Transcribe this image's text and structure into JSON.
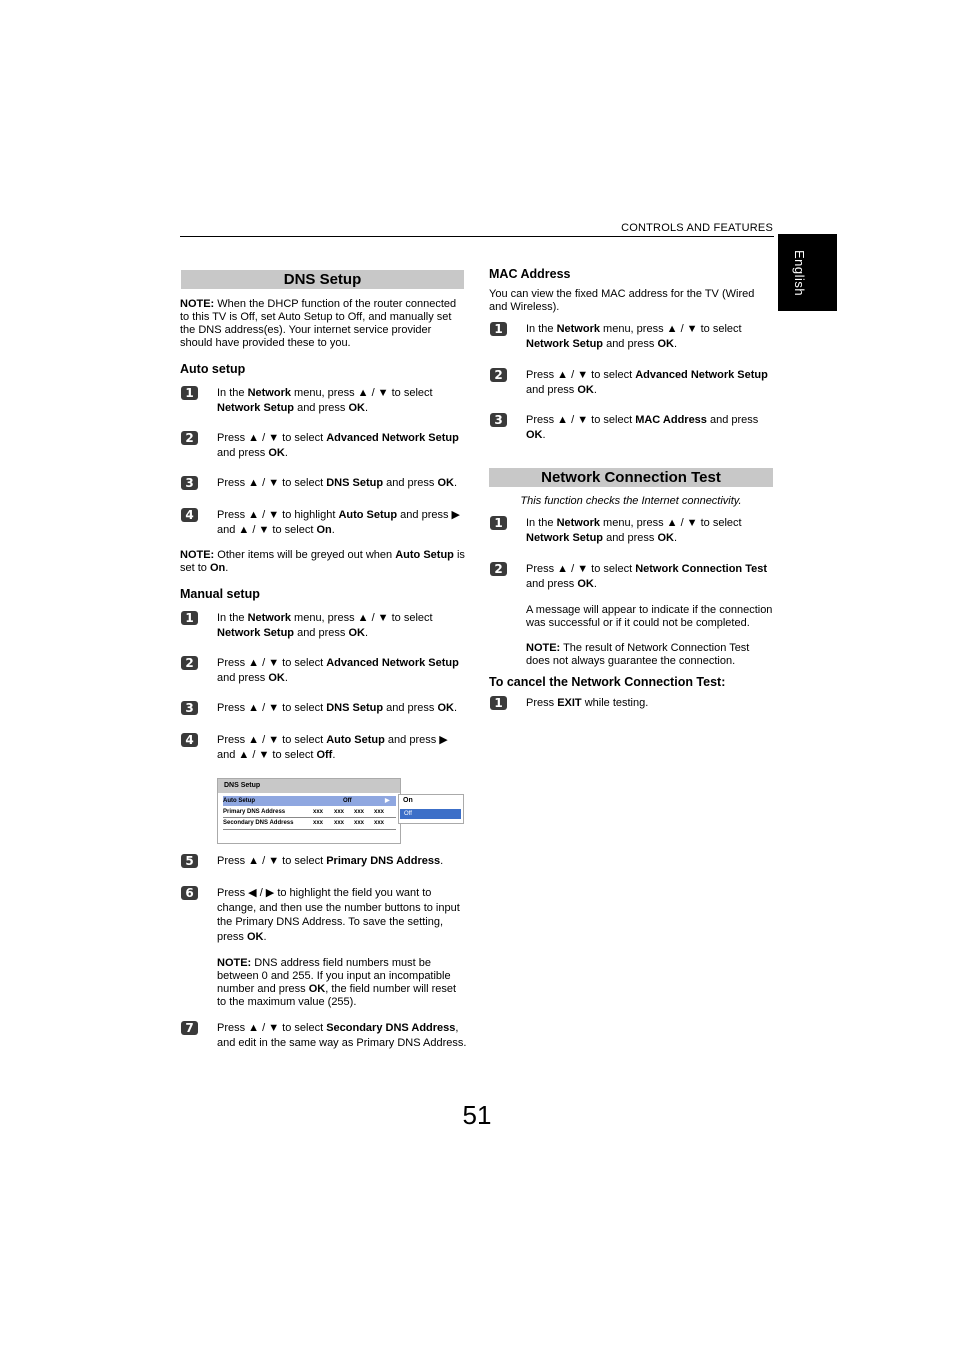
{
  "header": {
    "section_label": "CONTROLS AND FEATURES",
    "language_tab": "English"
  },
  "dns_setup": {
    "title": "DNS Setup",
    "note_label": "NOTE:",
    "note_text": " When the DHCP function of the router connected to this TV is Off, set Auto Setup to Off, and manually set the DNS address(es). Your internet service provider should have provided these to you.",
    "auto_setup": {
      "heading": "Auto setup",
      "steps": [
        {
          "num": "1",
          "html": "In the <b>Network</b> menu, press ▲ / ▼ to select <b>Network Setup</b> and press <b>OK</b>."
        },
        {
          "num": "2",
          "html": "Press ▲ / ▼ to select <b>Advanced Network Setup</b> and press <b>OK</b>."
        },
        {
          "num": "3",
          "html": "Press ▲ / ▼ to select <b>DNS Setup</b> and press <b>OK</b>."
        },
        {
          "num": "4",
          "html": "Press ▲ / ▼ to highlight <b>Auto Setup</b> and press ▶ and ▲ / ▼ to select <b>On</b>."
        }
      ],
      "note_html": "<b>NOTE:</b> Other items will be greyed out when <b>Auto Setup</b> is set to <b>On</b>."
    },
    "manual_setup": {
      "heading": "Manual setup",
      "steps": [
        {
          "num": "1",
          "html": "In the <b>Network</b> menu, press ▲ / ▼ to select <b>Network Setup</b> and press <b>OK</b>."
        },
        {
          "num": "2",
          "html": "Press ▲ / ▼ to select <b>Advanced Network Setup</b> and press <b>OK</b>."
        },
        {
          "num": "3",
          "html": "Press ▲ / ▼ to select <b>DNS Setup</b> and press <b>OK</b>."
        },
        {
          "num": "4",
          "html": "Press ▲ / ▼ to select <b>Auto Setup</b> and press ▶ and ▲ / ▼ to select <b>Off</b>."
        },
        {
          "num": "5",
          "html": "Press ▲ / ▼ to select <b>Primary DNS Address</b>."
        },
        {
          "num": "6",
          "html": "Press ◀ / ▶ to highlight the field you want to change, and then use the number buttons to input the Primary DNS Address. To save the setting, press <b>OK</b>."
        },
        {
          "num": "7",
          "html": "Press ▲ / ▼ to select <b>Secondary DNS Address</b>, and edit in the same way as Primary DNS Address."
        }
      ],
      "step6_note_html": "<b>NOTE:</b> DNS address field numbers must be between 0 and 255. If you input an incompatible number and press <b>OK</b>, the field number will reset to the maximum value (255)."
    },
    "osd": {
      "title": "DNS Setup",
      "rows": [
        {
          "label": "Auto Setup",
          "value": "Off",
          "arrow": "▶"
        },
        {
          "label": "Primary DNS Address",
          "fields": [
            "xxx",
            "xxx",
            "xxx",
            "xxx"
          ]
        },
        {
          "label": "Secondary DNS Address",
          "fields": [
            "xxx",
            "xxx",
            "xxx",
            "xxx"
          ]
        }
      ],
      "popup_options": [
        "On",
        "Off"
      ],
      "popup_selected": "Off"
    }
  },
  "mac_address": {
    "heading": "MAC Address",
    "intro": "You can view the fixed MAC address for the TV (Wired and Wireless).",
    "steps": [
      {
        "num": "1",
        "html": "In the <b>Network</b> menu, press ▲ / ▼ to select <b>Network Setup</b> and press <b>OK</b>."
      },
      {
        "num": "2",
        "html": "Press ▲ / ▼ to select <b>Advanced Network Setup</b> and press <b>OK</b>."
      },
      {
        "num": "3",
        "html": "Press ▲ / ▼ to select <b>MAC Address</b> and press <b>OK</b>."
      }
    ]
  },
  "network_test": {
    "title": "Network Connection Test",
    "subtitle": "This function checks the Internet connectivity.",
    "steps": [
      {
        "num": "1",
        "html": "In the <b>Network</b> menu, press ▲ / ▼ to select <b>Network Setup</b> and press <b>OK</b>."
      },
      {
        "num": "2",
        "html": "Press ▲ / ▼ to select <b>Network Connection Test</b> and press <b>OK</b>."
      }
    ],
    "message_text": "A message will appear to indicate if the connection was successful or if it could not be completed.",
    "note_html": "<b>NOTE:</b> The result of Network Connection Test does not always guarantee the connection.",
    "cancel_heading": "To cancel the Network Connection Test:",
    "cancel_steps": [
      {
        "num": "1",
        "html": "Press <b>EXIT</b> while testing."
      }
    ]
  },
  "page_number": "51"
}
